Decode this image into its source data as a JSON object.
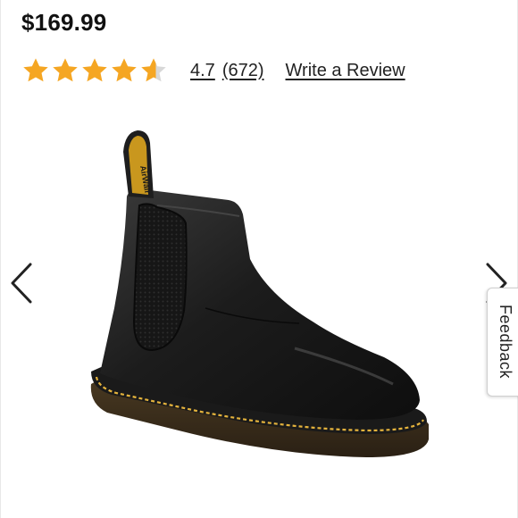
{
  "product": {
    "price": "$169.99",
    "rating": {
      "value": "4.7",
      "count": "(672)",
      "stars_fraction": 0.94
    },
    "write_review_label": "Write a Review"
  },
  "carousel": {
    "image_label": "Black leather Chelsea boot with yellow stitching and pull tab",
    "pull_tab_text": "AirWair"
  },
  "feedback": {
    "label": "Feedback"
  },
  "colors": {
    "star": "#f5a623",
    "star_empty": "#d8d8d8",
    "text": "#111111",
    "stitch": "#e3b23c"
  },
  "icons": [
    "star-icon",
    "chevron-left-icon",
    "chevron-right-icon"
  ]
}
